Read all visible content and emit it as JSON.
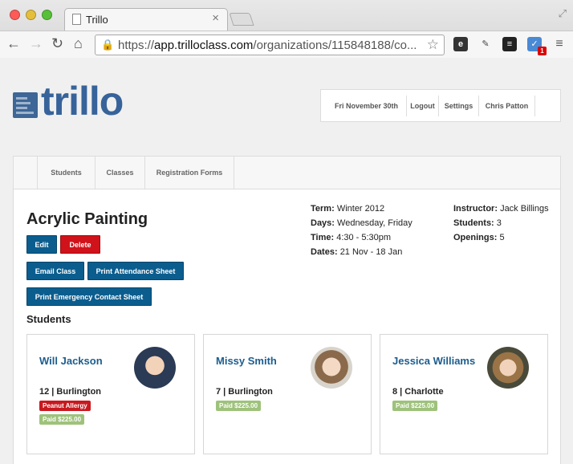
{
  "browser": {
    "tab_title": "Trillo",
    "url_prefix": "https://",
    "url_host": "app.trilloclass.com",
    "url_path": "/organizations/115848188/co...",
    "ext_badge": "1"
  },
  "brand": {
    "logo_text": "trillo",
    "accent": "#37639a"
  },
  "topnav": {
    "date": "Fri November 30th",
    "logout": "Logout",
    "settings": "Settings",
    "user": "Chris Patton"
  },
  "tabs": [
    "Students",
    "Classes",
    "Registration Forms"
  ],
  "class": {
    "title": "Acrylic Painting",
    "edit": "Edit",
    "delete": "Delete",
    "email": "Email Class",
    "print_attendance": "Print Attendance Sheet",
    "print_emergency": "Print Emergency Contact Sheet",
    "term_label": "Term:",
    "term": "Winter 2012",
    "days_label": "Days:",
    "days": "Wednesday, Friday",
    "time_label": "Time:",
    "time": "4:30 - 5:30pm",
    "dates_label": "Dates:",
    "dates": "21 Nov - 18 Jan",
    "instructor_label": "Instructor:",
    "instructor": "Jack Billings",
    "students_label": "Students:",
    "students": "3",
    "openings_label": "Openings:",
    "openings": "5"
  },
  "students_heading": "Students",
  "students": [
    {
      "name": "Will Jackson",
      "location": "12 | Burlington",
      "allergy": "Peanut Allergy",
      "paid": "Paid $225.00"
    },
    {
      "name": "Missy Smith",
      "location": "7 | Burlington",
      "paid": "Paid $225.00"
    },
    {
      "name": "Jessica Williams",
      "location": "8 | Charlotte",
      "paid": "Paid $225.00"
    }
  ]
}
